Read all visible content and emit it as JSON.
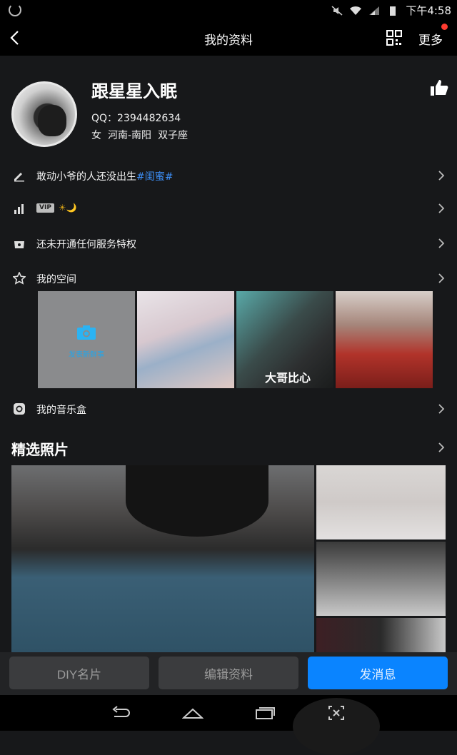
{
  "status_bar": {
    "time": "下午4:58"
  },
  "nav": {
    "title": "我的资料",
    "more_label": "更多"
  },
  "profile": {
    "nickname": "跟星星入眠",
    "qq": "QQ：2394482634",
    "gender": "女",
    "location": "河南-南阳",
    "zodiac": "双子座"
  },
  "rows": {
    "signature": {
      "text": "敢动小爷的人还没出生",
      "tag": "#闺蜜#"
    },
    "level": {
      "vip_badge": "VIP",
      "emoji": "☀🌙"
    },
    "services": {
      "label": "还未开通任何服务特权"
    },
    "space": {
      "label": "我的空间"
    },
    "music": {
      "label": "我的音乐盒"
    }
  },
  "space_thumbs": {
    "add_label": "发表新鲜事",
    "caption": "大哥比心"
  },
  "gallery": {
    "title": "精选照片"
  },
  "actions": {
    "diy": "DIY名片",
    "edit": "编辑资料",
    "message": "发消息"
  },
  "colors": {
    "accent": "#0a84ff",
    "tag": "#3d8ff7",
    "badge_dot": "#ff3b30"
  }
}
